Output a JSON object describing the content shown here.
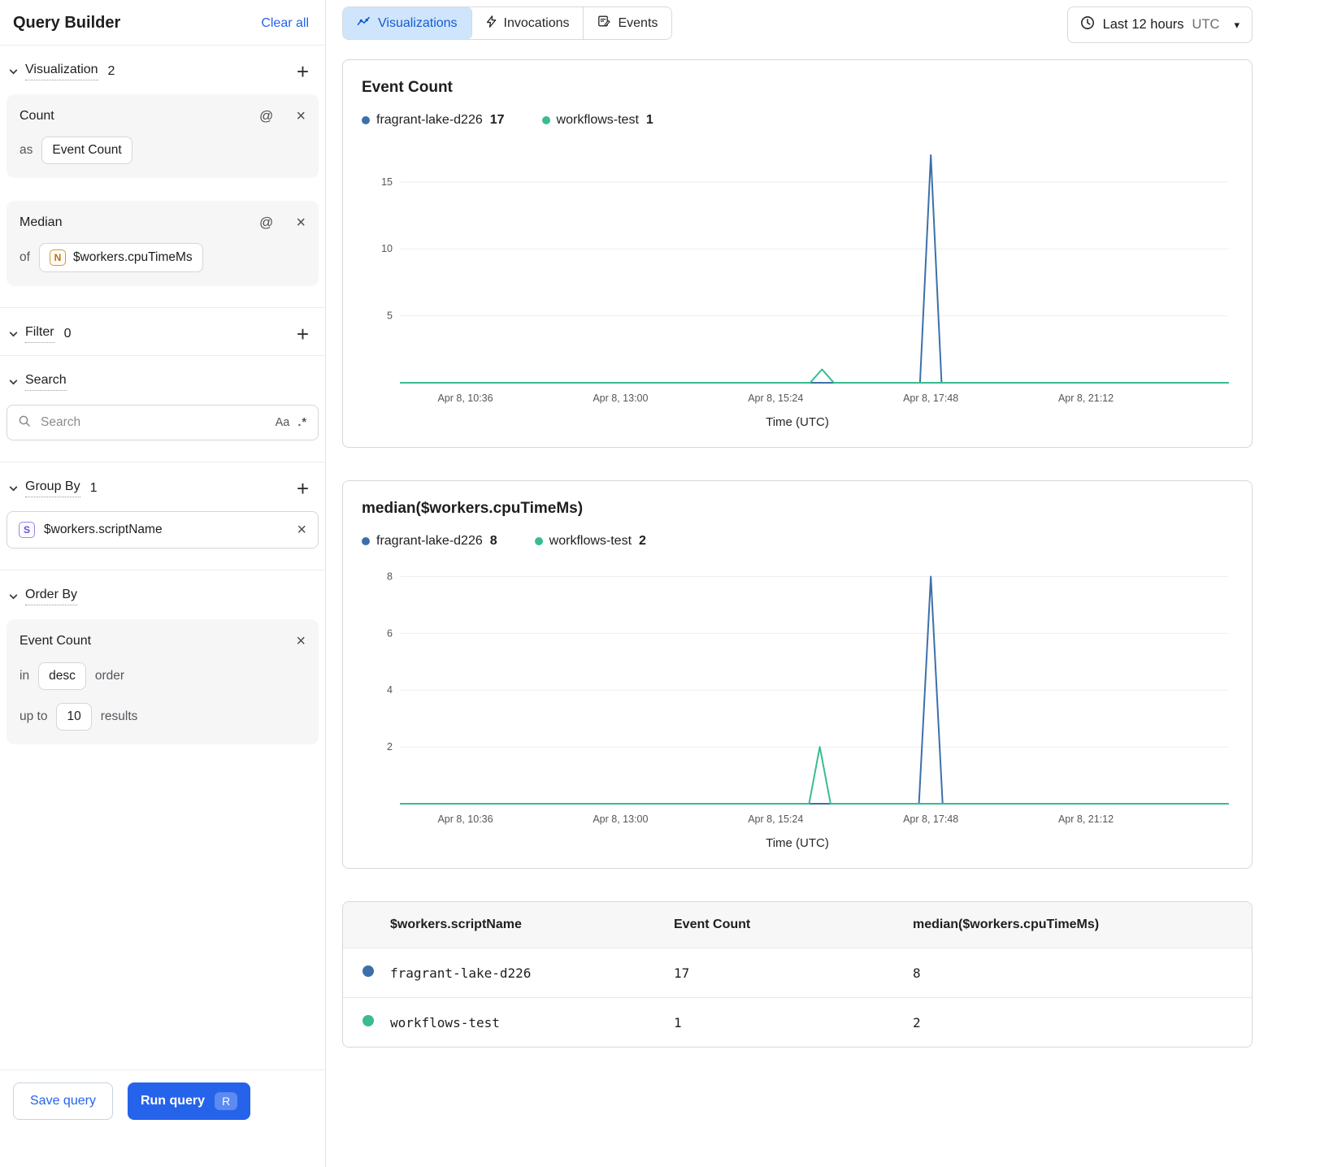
{
  "icons": {
    "at": "@",
    "close": "×",
    "plus": "+",
    "case": "Aa",
    "regex": ".*",
    "caret": "▾"
  },
  "colors": {
    "accent": "#2563eb",
    "blue_series": "#3d70aa",
    "green_series": "#39bd8e"
  },
  "sidebar": {
    "title": "Query Builder",
    "clear_all": "Clear all",
    "visualization": {
      "label": "Visualization",
      "count": "2"
    },
    "count_card": {
      "title": "Count",
      "as_label": "as",
      "as_value": "Event Count"
    },
    "median_card": {
      "title": "Median",
      "of_label": "of",
      "field_type": "N",
      "field": "$workers.cpuTimeMs"
    },
    "filter": {
      "label": "Filter",
      "count": "0"
    },
    "search": {
      "label": "Search",
      "placeholder": "Search"
    },
    "group_by": {
      "label": "Group By",
      "count": "1",
      "field_type": "S",
      "field": "$workers.scriptName"
    },
    "order_by": {
      "label": "Order By",
      "card_title": "Event Count",
      "in_label": "in",
      "order": "desc",
      "order_suffix": "order",
      "up_to_label": "up to",
      "limit": "10",
      "results_label": "results"
    },
    "save_query": "Save query",
    "run_query": "Run query",
    "run_shortcut": "R"
  },
  "tabs": [
    {
      "label": "Visualizations"
    },
    {
      "label": "Invocations"
    },
    {
      "label": "Events"
    }
  ],
  "time_range": {
    "label": "Last 12 hours",
    "zone": "UTC"
  },
  "chart_data": [
    {
      "type": "line",
      "title": "Event Count",
      "xlabel": "Time (UTC)",
      "legend": [
        {
          "name": "fragrant-lake-d226",
          "value": "17",
          "color": "#3d70aa"
        },
        {
          "name": "workflows-test",
          "value": "1",
          "color": "#39bd8e"
        }
      ],
      "x_domain": [
        0,
        768
      ],
      "x_ticks": [
        {
          "pos": 60,
          "label": "Apr 8, 10:36"
        },
        {
          "pos": 204,
          "label": "Apr 8, 13:00"
        },
        {
          "pos": 348,
          "label": "Apr 8, 15:24"
        },
        {
          "pos": 492,
          "label": "Apr 8, 17:48"
        },
        {
          "pos": 636,
          "label": "Apr 8, 21:12"
        }
      ],
      "y_ticks": [
        5,
        10,
        15
      ],
      "ylim": [
        0,
        17.6
      ],
      "series": [
        {
          "name": "fragrant-lake-d226",
          "color": "#3d70aa",
          "points": [
            [
              0,
              0
            ],
            [
              482,
              0
            ],
            [
              492,
              17
            ],
            [
              502,
              0
            ],
            [
              768,
              0
            ]
          ]
        },
        {
          "name": "workflows-test",
          "color": "#39bd8e",
          "points": [
            [
              0,
              0
            ],
            [
              380,
              0
            ],
            [
              391,
              1
            ],
            [
              402,
              0
            ],
            [
              768,
              0
            ]
          ]
        }
      ]
    },
    {
      "type": "line",
      "title": "median($workers.cpuTimeMs)",
      "xlabel": "Time (UTC)",
      "legend": [
        {
          "name": "fragrant-lake-d226",
          "value": "8",
          "color": "#3d70aa"
        },
        {
          "name": "workflows-test",
          "value": "2",
          "color": "#39bd8e"
        }
      ],
      "x_domain": [
        0,
        768
      ],
      "x_ticks": [
        {
          "pos": 60,
          "label": "Apr 8, 10:36"
        },
        {
          "pos": 204,
          "label": "Apr 8, 13:00"
        },
        {
          "pos": 348,
          "label": "Apr 8, 15:24"
        },
        {
          "pos": 492,
          "label": "Apr 8, 17:48"
        },
        {
          "pos": 636,
          "label": "Apr 8, 21:12"
        }
      ],
      "y_ticks": [
        2,
        4,
        6,
        8
      ],
      "ylim": [
        0,
        8.3
      ],
      "series": [
        {
          "name": "fragrant-lake-d226",
          "color": "#3d70aa",
          "points": [
            [
              0,
              0
            ],
            [
              481,
              0
            ],
            [
              492,
              8
            ],
            [
              503,
              0
            ],
            [
              768,
              0
            ]
          ]
        },
        {
          "name": "workflows-test",
          "color": "#39bd8e",
          "points": [
            [
              0,
              0
            ],
            [
              379,
              0
            ],
            [
              389,
              2
            ],
            [
              399,
              0
            ],
            [
              768,
              0
            ]
          ]
        }
      ]
    }
  ],
  "table": {
    "headers": [
      "$workers.scriptName",
      "Event Count",
      "median($workers.cpuTimeMs)"
    ],
    "rows": [
      {
        "color": "#3d70aa",
        "name": "fragrant-lake-d226",
        "event_count": "17",
        "median": "8"
      },
      {
        "color": "#39bd8e",
        "name": "workflows-test",
        "event_count": "1",
        "median": "2"
      }
    ]
  }
}
